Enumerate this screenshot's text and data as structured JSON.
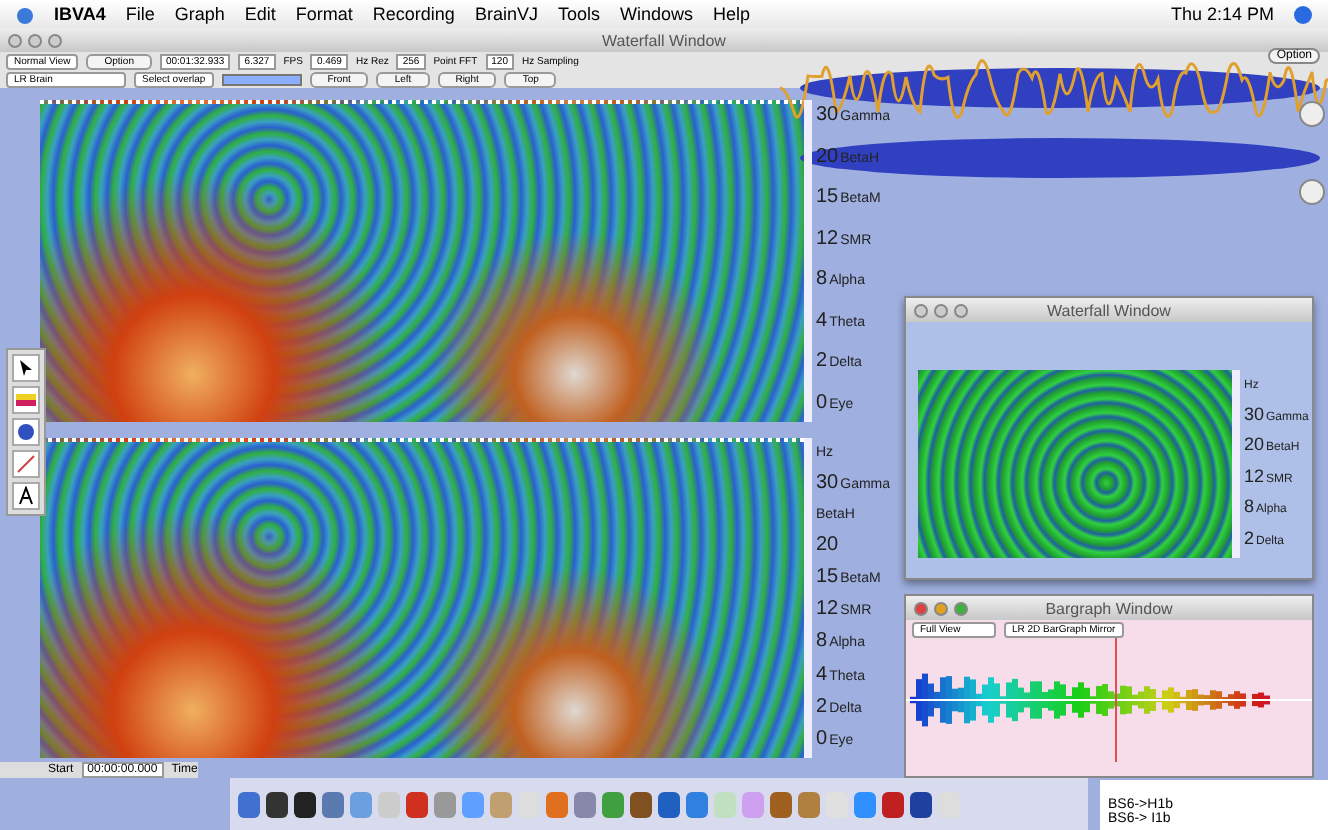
{
  "menu_bar": {
    "app": "IBVA4",
    "menus": [
      "File",
      "Graph",
      "Edit",
      "Format",
      "Recording",
      "BrainVJ",
      "Tools",
      "Windows",
      "Help"
    ],
    "clock": "Thu 2:14 PM"
  },
  "main_window": {
    "title": "Waterfall Window",
    "view_select": "Normal View",
    "option_button": "Option",
    "time": "00:01:32.933",
    "fps": "6.327",
    "fps_label": "FPS",
    "hz_res": "0.469",
    "hz_res_label": "Hz Rez",
    "fft_points": "256",
    "fft_label": "Point FFT",
    "sampling": "120",
    "sampling_label": "Hz Sampling",
    "brain_select": "LR Brain",
    "overlap_select": "Select overlap",
    "view_buttons": [
      "Front",
      "Left",
      "Right",
      "Top"
    ]
  },
  "plots": [
    {
      "axis": [
        {
          "num": "30",
          "band": "Gamma"
        },
        {
          "num": "20",
          "band": "BetaH"
        },
        {
          "num": "15",
          "band": "BetaM"
        },
        {
          "num": "12",
          "band": "SMR"
        },
        {
          "num": "8",
          "band": "Alpha"
        },
        {
          "num": "4",
          "band": "Theta"
        },
        {
          "num": "2",
          "band": "Delta"
        },
        {
          "num": "0",
          "band": "Eye"
        }
      ]
    },
    {
      "axis": [
        {
          "band": "Hz"
        },
        {
          "num": "30",
          "band": "Gamma"
        },
        {
          "band": "BetaH"
        },
        {
          "num": "20"
        },
        {
          "num": "15",
          "band": "BetaM"
        },
        {
          "num": "12",
          "band": "SMR"
        },
        {
          "num": "8",
          "band": "Alpha"
        },
        {
          "num": "4",
          "band": "Theta"
        },
        {
          "num": "2",
          "band": "Delta"
        },
        {
          "num": "0",
          "band": "Eye"
        }
      ]
    }
  ],
  "widget": {
    "option_button": "Option"
  },
  "playback": {
    "start_label": "Start",
    "start_time": "00:00:00.000",
    "time_label": "Time"
  },
  "waterfall_window": {
    "title": "Waterfall Window",
    "axis": [
      {
        "band": "Hz"
      },
      {
        "num": "30",
        "band": "Gamma"
      },
      {
        "num": "20",
        "band": "BetaH"
      },
      {
        "num": "12",
        "band": "SMR"
      },
      {
        "num": "8",
        "band": "Alpha"
      },
      {
        "num": "2",
        "band": "Delta"
      }
    ]
  },
  "bargraph_window": {
    "title": "Bargraph Window",
    "view_select": "Full View",
    "mode_select": "LR 2D BarGraph Mirror"
  },
  "console_lines": [
    "BS6->H1b",
    "BS6-> I1b"
  ]
}
